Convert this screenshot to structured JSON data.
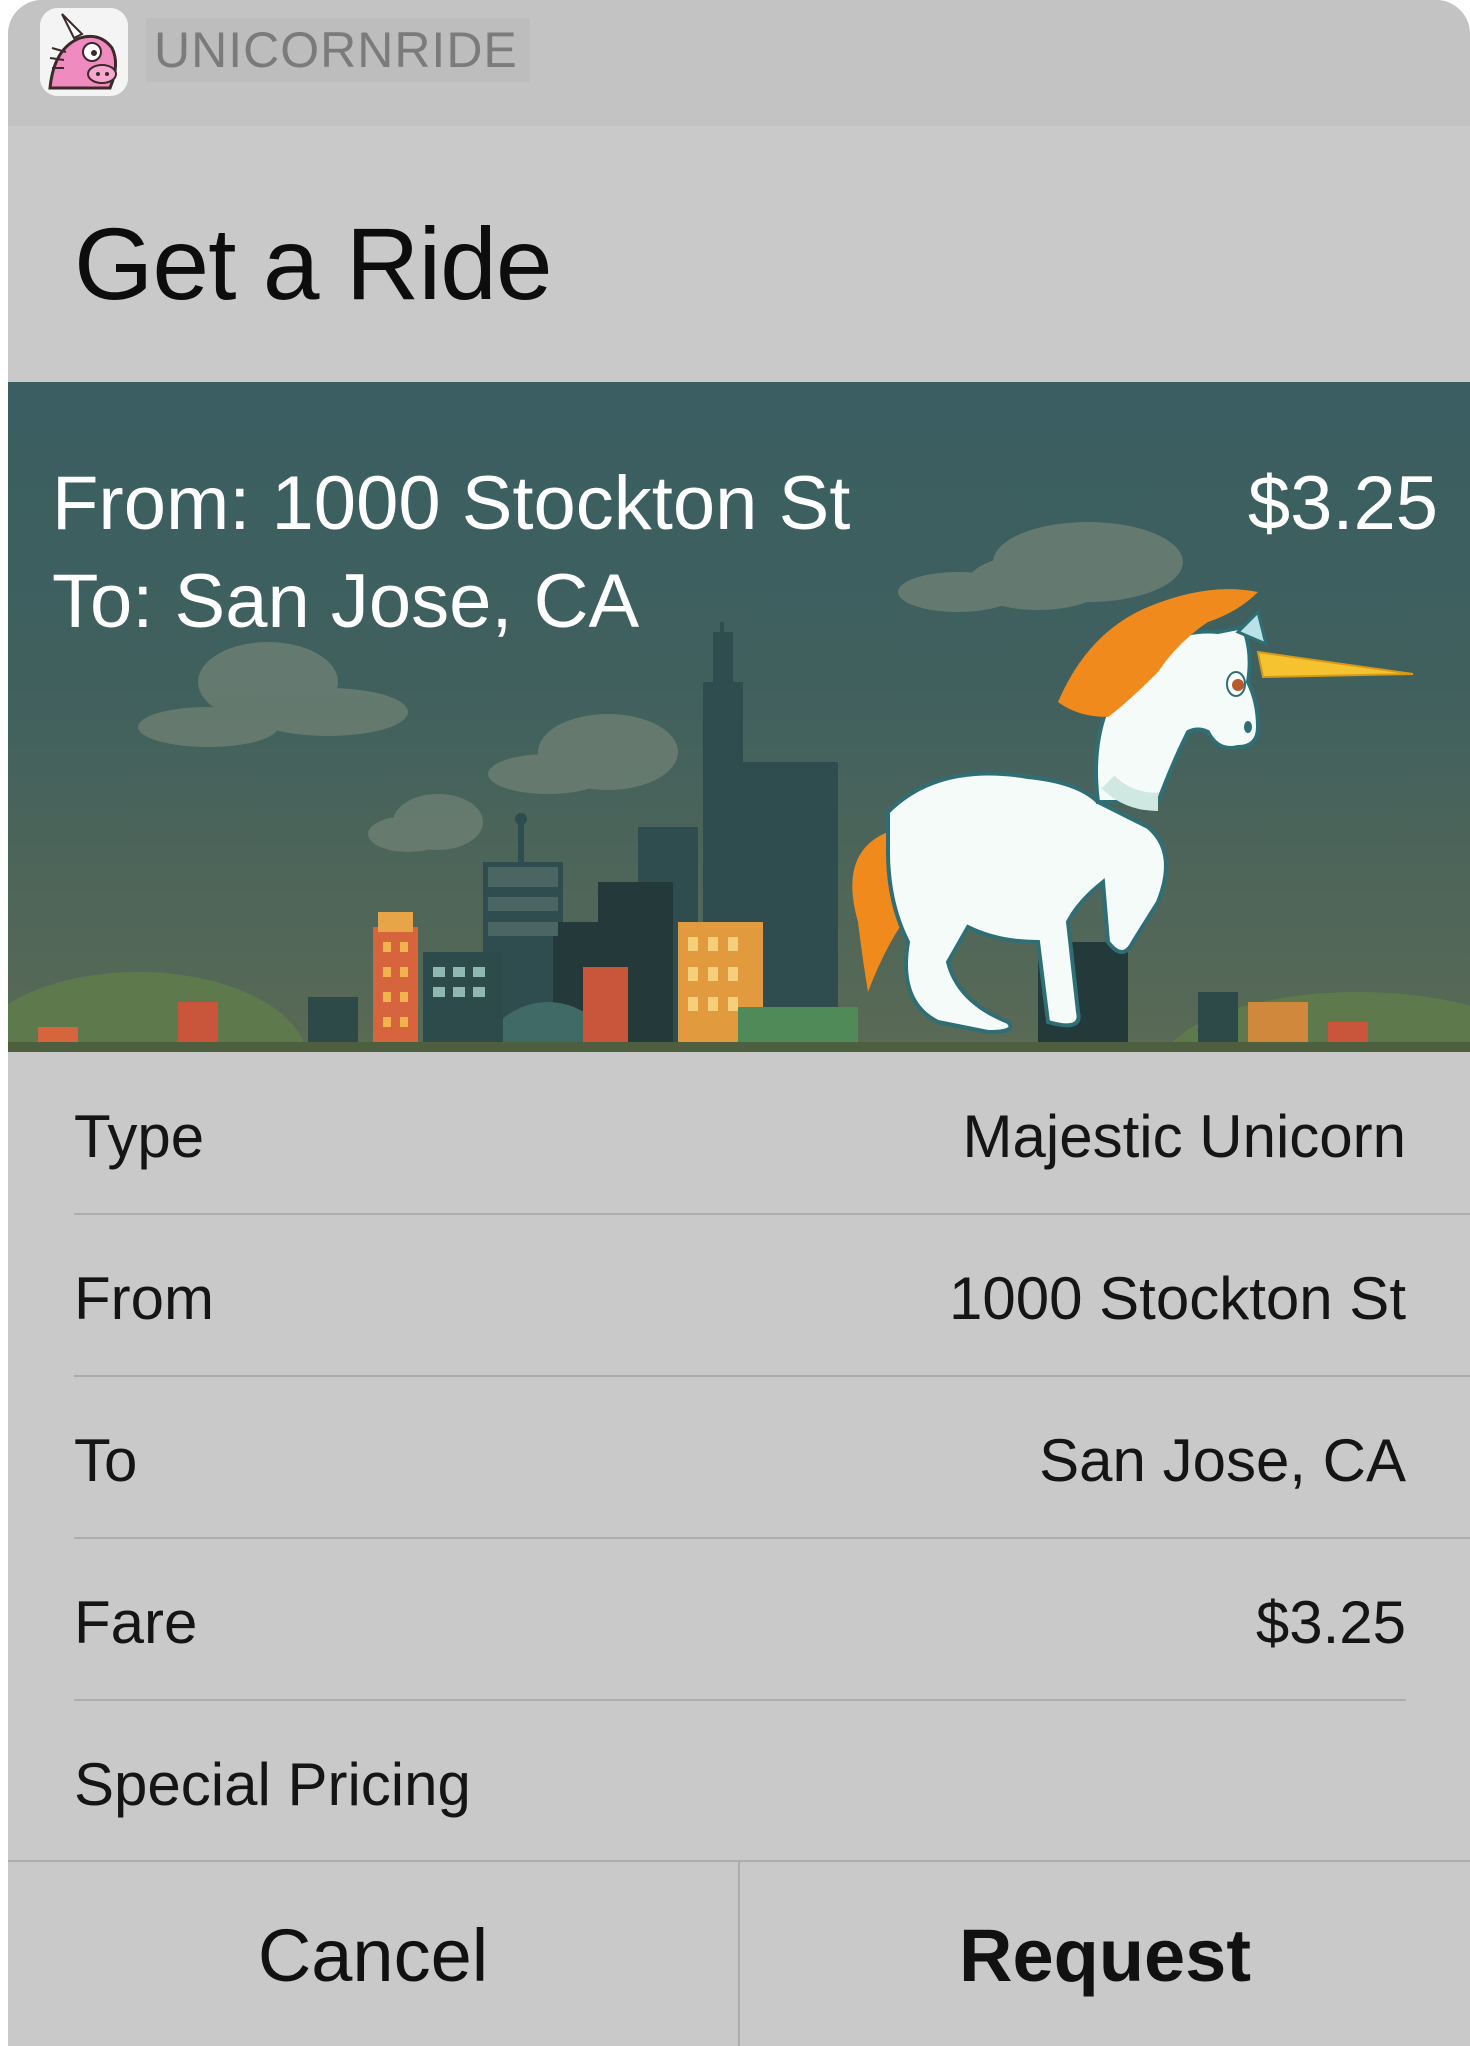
{
  "app": {
    "name": "UNICORNRIDE",
    "icon": "unicorn-app-icon"
  },
  "title": "Get a Ride",
  "banner": {
    "from_line": "From: 1000 Stockton St",
    "to_line": "To: San Jose, CA",
    "price": "$3.25",
    "illustration": "unicorn-over-city-skyline"
  },
  "details": [
    {
      "label": "Type",
      "value": "Majestic Unicorn"
    },
    {
      "label": "From",
      "value": "1000 Stockton St"
    },
    {
      "label": "To",
      "value": "San Jose, CA"
    },
    {
      "label": "Fare",
      "value": "$3.25"
    },
    {
      "label": "Special Pricing",
      "value": ""
    }
  ],
  "actions": {
    "cancel_label": "Cancel",
    "request_label": "Request"
  },
  "colors": {
    "sheet_background": "#c9c9c9",
    "banner_teal": "#3a5e62",
    "mane_orange": "#f08a1c",
    "horn_gold": "#f5c330"
  }
}
